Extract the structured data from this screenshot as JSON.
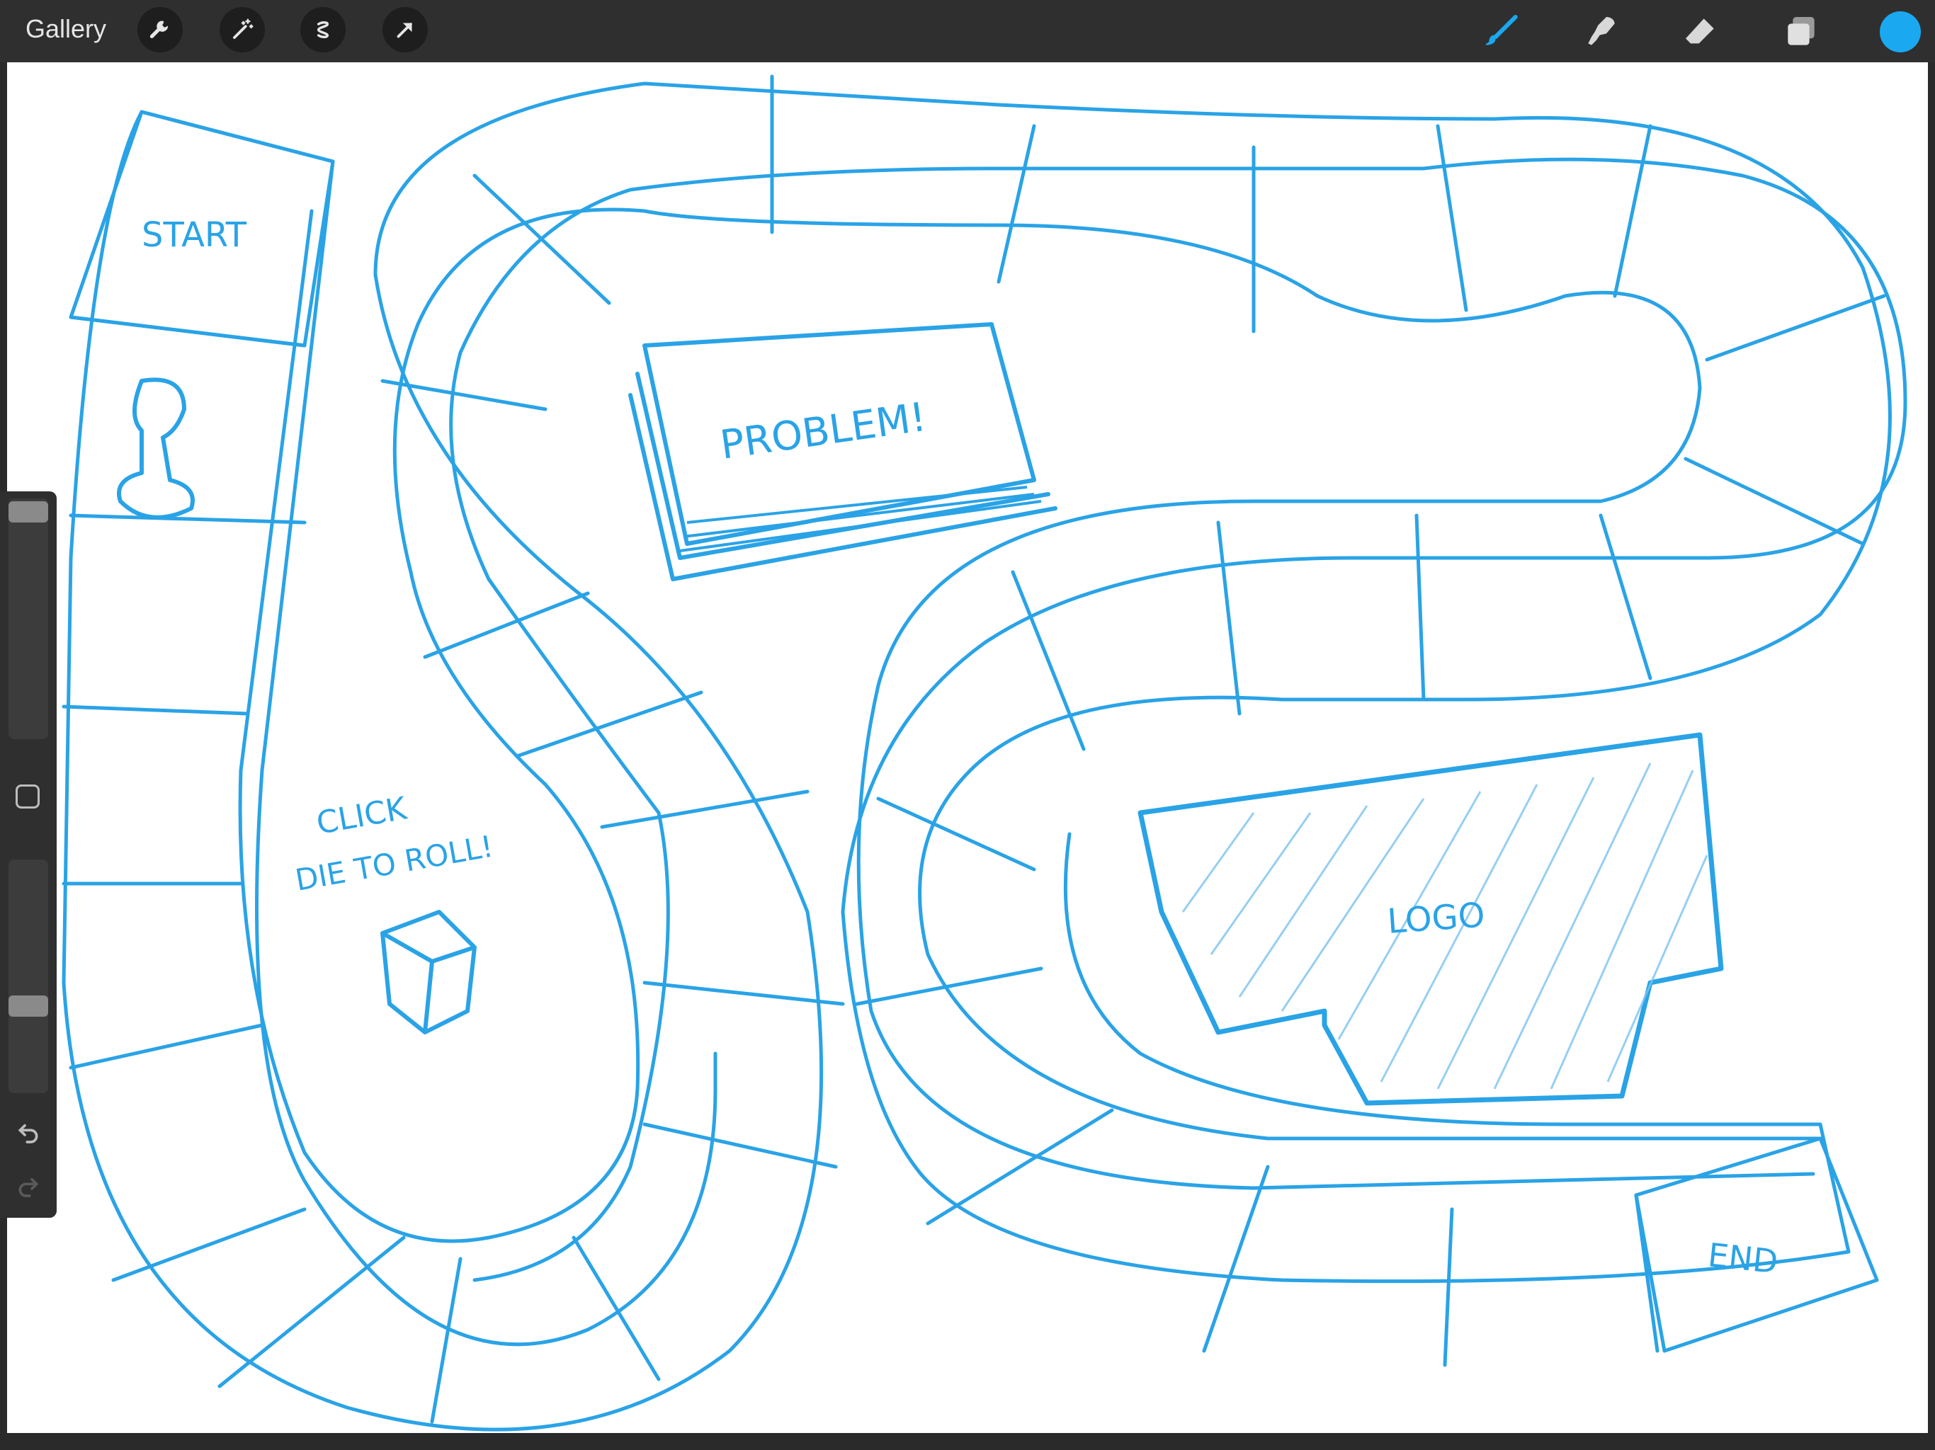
{
  "header": {
    "gallery_label": "Gallery",
    "left_tools": [
      "wrench-icon",
      "magic-wand-icon",
      "selection-icon",
      "transform-arrow-icon"
    ],
    "right_tools": [
      "brush-icon",
      "smudge-icon",
      "eraser-icon",
      "layers-icon"
    ],
    "current_color": "#1aa9f0"
  },
  "sidebar": {
    "brush_size_level": 0.02,
    "opacity_level": 0.62
  },
  "canvas": {
    "labels": {
      "start": "START",
      "problem": "PROBLEM!",
      "click": "CLICK",
      "die_to_roll": "DIE TO ROLL!",
      "logo": "LOGO",
      "end": "END"
    },
    "stroke_color": "#2aa3e6"
  }
}
